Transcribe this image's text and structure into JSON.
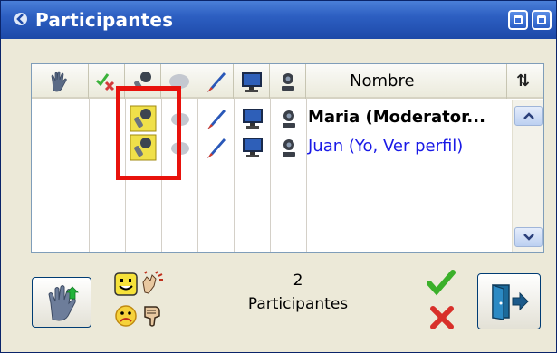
{
  "window": {
    "title": "Participantes",
    "icons": {
      "app": "chevron-logo-icon",
      "restore": "restore-icon",
      "maximize": "maximize-icon"
    }
  },
  "table": {
    "columns": [
      {
        "id": "hand",
        "icon": "raise-hand-icon"
      },
      {
        "id": "permission",
        "icon": "check-cross-icon"
      },
      {
        "id": "microphone",
        "icon": "microphone-icon"
      },
      {
        "id": "chat",
        "icon": "chat-bubble-icon"
      },
      {
        "id": "draw",
        "icon": "pen-icon"
      },
      {
        "id": "screen",
        "icon": "monitor-icon"
      },
      {
        "id": "webcam",
        "icon": "webcam-icon"
      },
      {
        "id": "name",
        "label": "Nombre"
      },
      {
        "id": "sort",
        "label": "⇅"
      }
    ],
    "rows": [
      {
        "name": "Maria (Moderator...",
        "style": "moderator"
      },
      {
        "name": "Juan (Yo, Ver perfil)",
        "style": "self"
      }
    ]
  },
  "footer": {
    "count_number": "2",
    "count_label": "Participantes",
    "emoticons": [
      "smile-icon",
      "applause-icon",
      "sad-icon",
      "thumbs-down-icon"
    ],
    "actions": {
      "raise_hand": "raise-hand-button",
      "approve": "check-icon",
      "deny": "cross-icon",
      "exit": "exit-door-button"
    }
  },
  "colors": {
    "titlebar": "#2d5fc2",
    "highlight": "#e8120c",
    "self_name": "#1a1ae6",
    "panel_bg": "#ece9d8"
  }
}
